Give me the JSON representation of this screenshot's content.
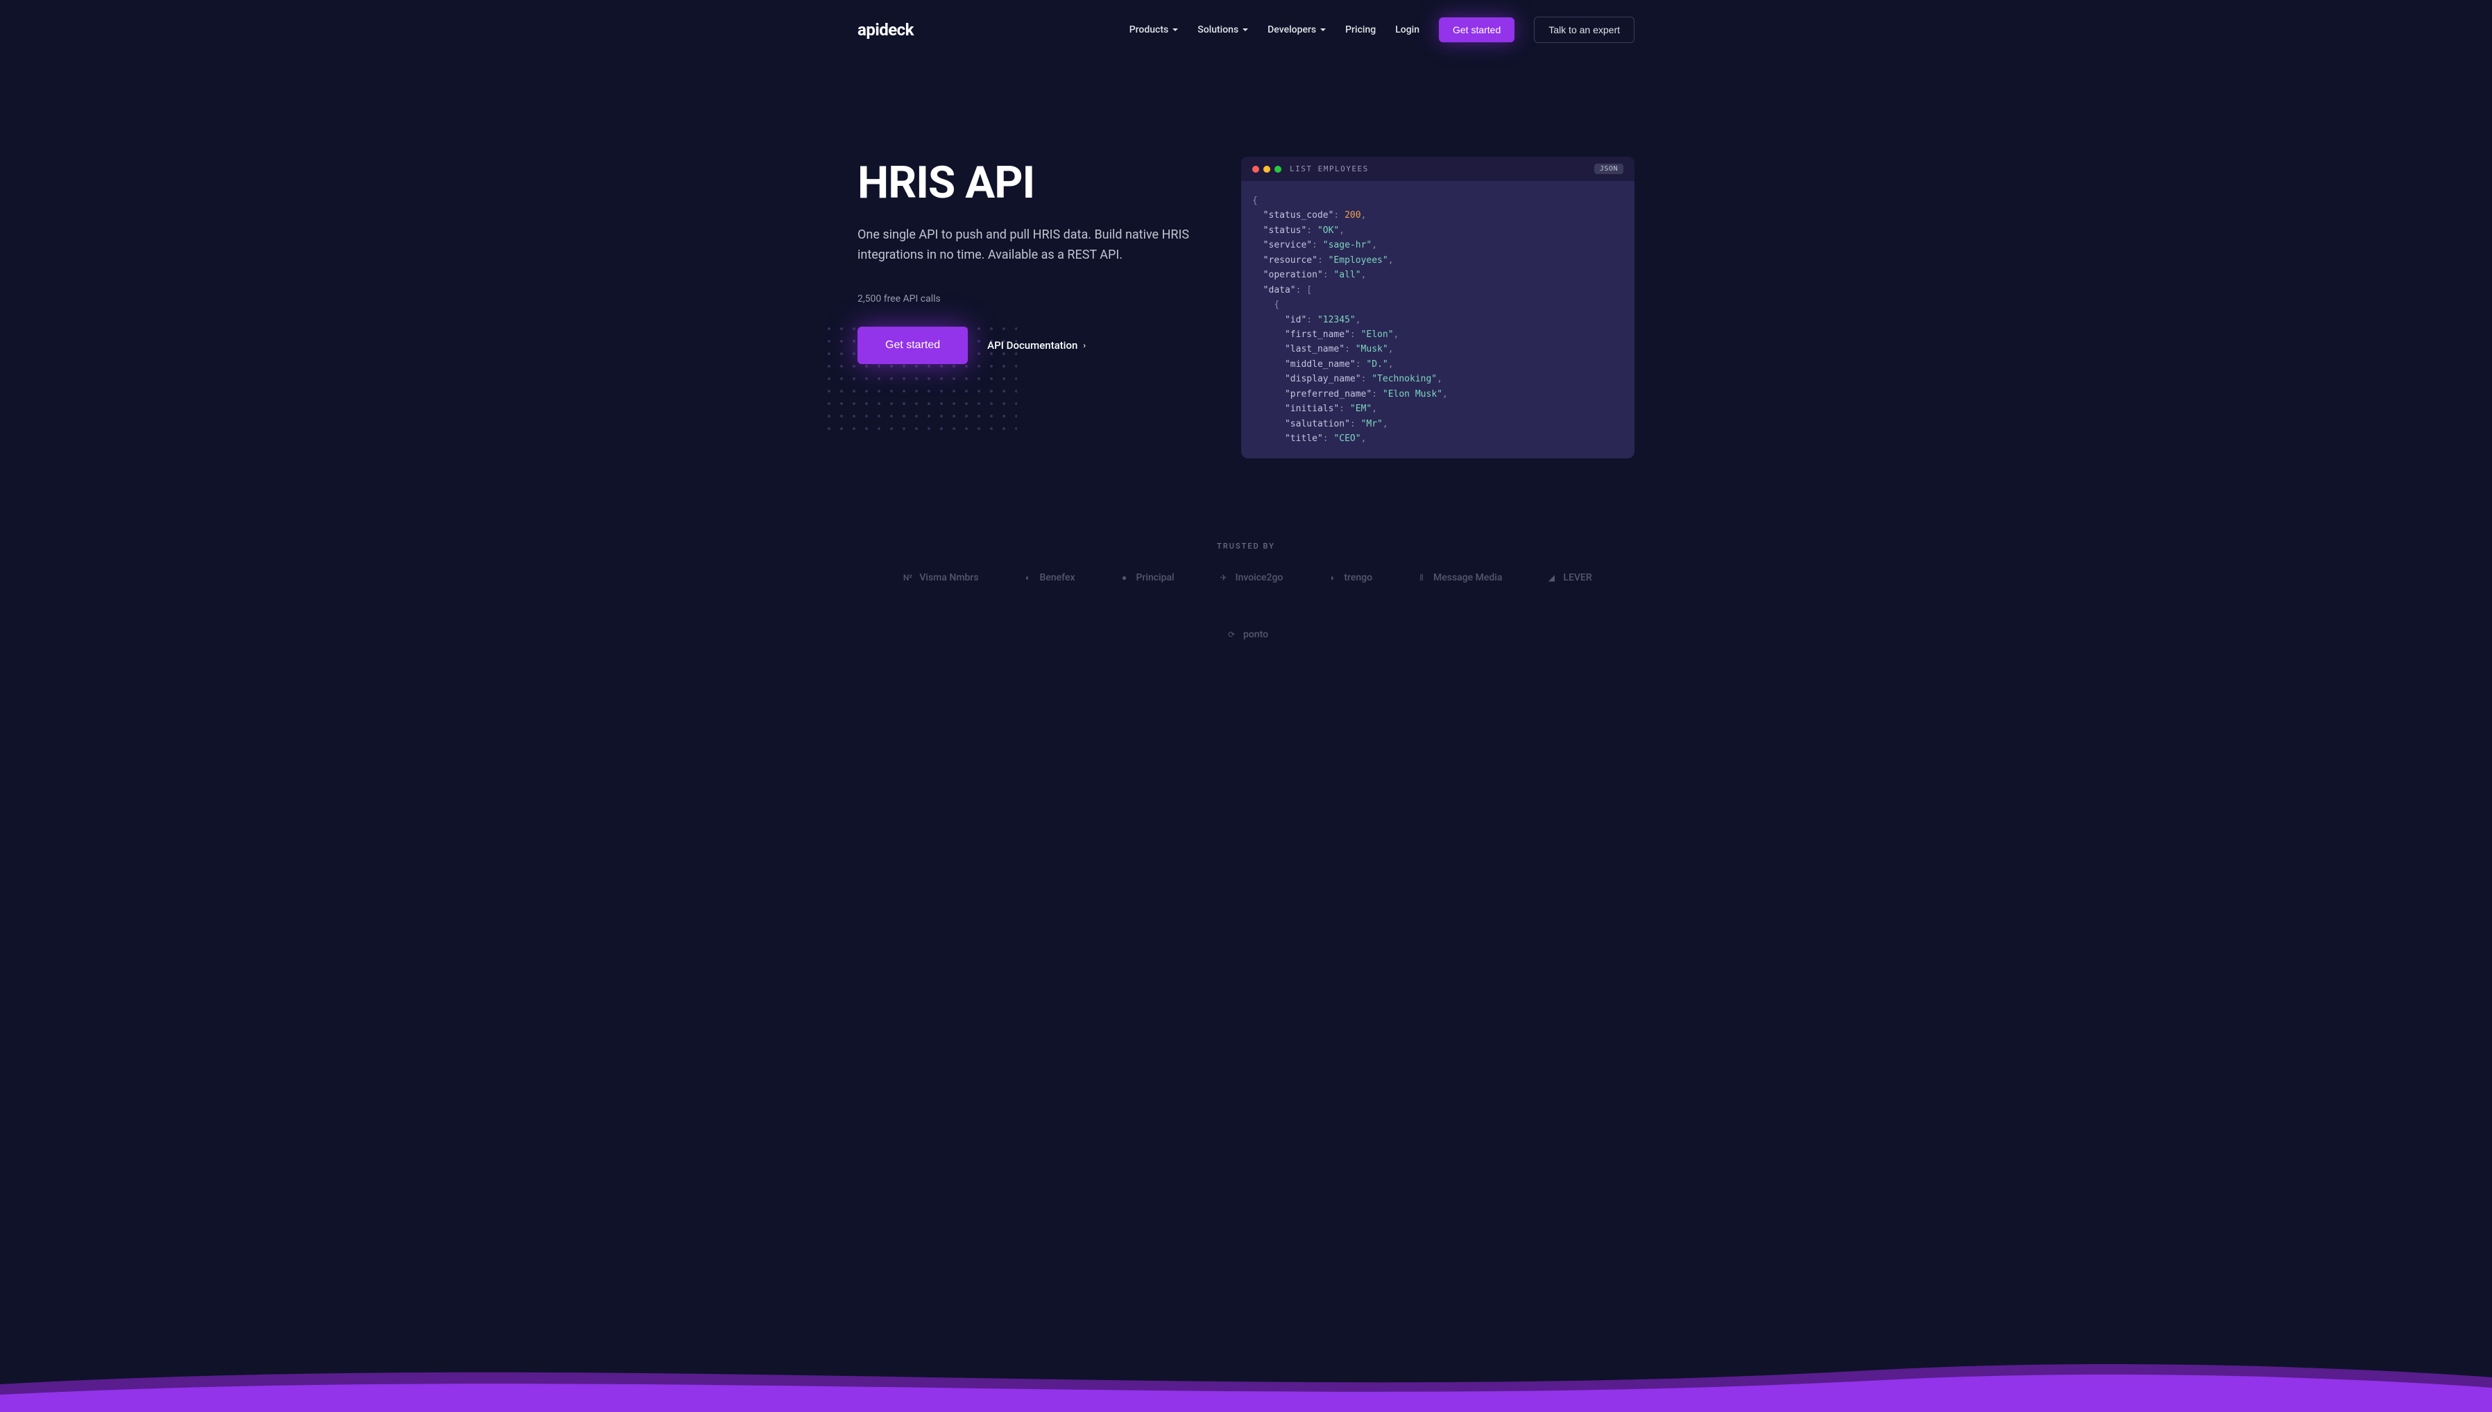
{
  "brand": "apideck",
  "nav": {
    "items": [
      {
        "label": "Products",
        "dropdown": true
      },
      {
        "label": "Solutions",
        "dropdown": true
      },
      {
        "label": "Developers",
        "dropdown": true
      },
      {
        "label": "Pricing",
        "dropdown": false
      },
      {
        "label": "Login",
        "dropdown": false
      }
    ],
    "cta_primary": "Get started",
    "cta_secondary": "Talk to an expert"
  },
  "hero": {
    "title": "HRIS API",
    "subtitle": "One single API to push and pull HRIS data. Build native HRIS integrations in no time. Available as a REST API.",
    "note": "2,500 free API calls",
    "cta": "Get started",
    "doc_link": "API Documentation"
  },
  "code": {
    "title": "LIST EMPLOYEES",
    "badge": "JSON",
    "lines": [
      {
        "indent": 0,
        "tokens": [
          {
            "t": "punct",
            "v": "{"
          }
        ]
      },
      {
        "indent": 1,
        "tokens": [
          {
            "t": "key",
            "v": "\"status_code\""
          },
          {
            "t": "punct",
            "v": ": "
          },
          {
            "t": "num",
            "v": "200"
          },
          {
            "t": "punct",
            "v": ","
          }
        ]
      },
      {
        "indent": 1,
        "tokens": [
          {
            "t": "key",
            "v": "\"status\""
          },
          {
            "t": "punct",
            "v": ": "
          },
          {
            "t": "str",
            "v": "\"OK\""
          },
          {
            "t": "punct",
            "v": ","
          }
        ]
      },
      {
        "indent": 1,
        "tokens": [
          {
            "t": "key",
            "v": "\"service\""
          },
          {
            "t": "punct",
            "v": ": "
          },
          {
            "t": "str",
            "v": "\"sage-hr\""
          },
          {
            "t": "punct",
            "v": ","
          }
        ]
      },
      {
        "indent": 1,
        "tokens": [
          {
            "t": "key",
            "v": "\"resource\""
          },
          {
            "t": "punct",
            "v": ": "
          },
          {
            "t": "str",
            "v": "\"Employees\""
          },
          {
            "t": "punct",
            "v": ","
          }
        ]
      },
      {
        "indent": 1,
        "tokens": [
          {
            "t": "key",
            "v": "\"operation\""
          },
          {
            "t": "punct",
            "v": ": "
          },
          {
            "t": "str",
            "v": "\"all\""
          },
          {
            "t": "punct",
            "v": ","
          }
        ]
      },
      {
        "indent": 1,
        "tokens": [
          {
            "t": "key",
            "v": "\"data\""
          },
          {
            "t": "punct",
            "v": ": ["
          }
        ]
      },
      {
        "indent": 2,
        "tokens": [
          {
            "t": "punct",
            "v": "{"
          }
        ]
      },
      {
        "indent": 3,
        "tokens": [
          {
            "t": "key",
            "v": "\"id\""
          },
          {
            "t": "punct",
            "v": ": "
          },
          {
            "t": "str",
            "v": "\"12345\""
          },
          {
            "t": "punct",
            "v": ","
          }
        ]
      },
      {
        "indent": 3,
        "tokens": [
          {
            "t": "key",
            "v": "\"first_name\""
          },
          {
            "t": "punct",
            "v": ": "
          },
          {
            "t": "str",
            "v": "\"Elon\""
          },
          {
            "t": "punct",
            "v": ","
          }
        ]
      },
      {
        "indent": 3,
        "tokens": [
          {
            "t": "key",
            "v": "\"last_name\""
          },
          {
            "t": "punct",
            "v": ": "
          },
          {
            "t": "str",
            "v": "\"Musk\""
          },
          {
            "t": "punct",
            "v": ","
          }
        ]
      },
      {
        "indent": 3,
        "tokens": [
          {
            "t": "key",
            "v": "\"middle_name\""
          },
          {
            "t": "punct",
            "v": ": "
          },
          {
            "t": "str",
            "v": "\"D.\""
          },
          {
            "t": "punct",
            "v": ","
          }
        ]
      },
      {
        "indent": 3,
        "tokens": [
          {
            "t": "key",
            "v": "\"display_name\""
          },
          {
            "t": "punct",
            "v": ": "
          },
          {
            "t": "str",
            "v": "\"Technoking\""
          },
          {
            "t": "punct",
            "v": ","
          }
        ]
      },
      {
        "indent": 3,
        "tokens": [
          {
            "t": "key",
            "v": "\"preferred_name\""
          },
          {
            "t": "punct",
            "v": ": "
          },
          {
            "t": "str",
            "v": "\"Elon Musk\""
          },
          {
            "t": "punct",
            "v": ","
          }
        ]
      },
      {
        "indent": 3,
        "tokens": [
          {
            "t": "key",
            "v": "\"initials\""
          },
          {
            "t": "punct",
            "v": ": "
          },
          {
            "t": "str",
            "v": "\"EM\""
          },
          {
            "t": "punct",
            "v": ","
          }
        ]
      },
      {
        "indent": 3,
        "tokens": [
          {
            "t": "key",
            "v": "\"salutation\""
          },
          {
            "t": "punct",
            "v": ": "
          },
          {
            "t": "str",
            "v": "\"Mr\""
          },
          {
            "t": "punct",
            "v": ","
          }
        ]
      },
      {
        "indent": 3,
        "tokens": [
          {
            "t": "key",
            "v": "\"title\""
          },
          {
            "t": "punct",
            "v": ": "
          },
          {
            "t": "str",
            "v": "\"CEO\""
          },
          {
            "t": "punct",
            "v": ","
          }
        ]
      }
    ]
  },
  "trusted": {
    "label": "TRUSTED BY",
    "partners": [
      "Visma Nmbrs",
      "Benefex",
      "Principal",
      "Invoice2go",
      "trengo",
      "Message Media",
      "LEVER",
      "ponto"
    ]
  }
}
